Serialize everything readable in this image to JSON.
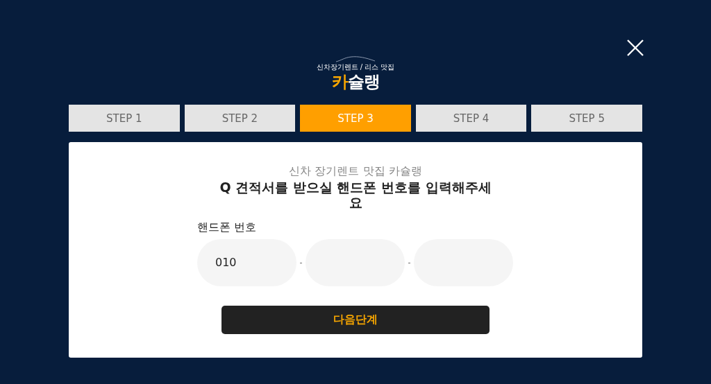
{
  "logo": {
    "tagline": "신차장기렌트 / 리스 맛집",
    "brand_accent": "카",
    "brand_rest": "슐랭"
  },
  "steps": [
    {
      "label": "STEP 1",
      "selected": false
    },
    {
      "label": "STEP 2",
      "selected": false
    },
    {
      "label": "STEP 3",
      "selected": true
    },
    {
      "label": "STEP 4",
      "selected": false
    },
    {
      "label": "STEP 5",
      "selected": false
    }
  ],
  "card": {
    "subtitle": "신차 장기렌트 맛집 카슐랭",
    "question": "Q 견적서를 받으실 핸드폰 번호를 입력해주세요",
    "phone_label": "핸드폰 번호",
    "phone_fields": [
      {
        "kind": "filled",
        "value": "010"
      },
      {
        "kind": "empty"
      },
      {
        "kind": "empty"
      }
    ],
    "separator": "-",
    "next_button": "다음단계"
  }
}
